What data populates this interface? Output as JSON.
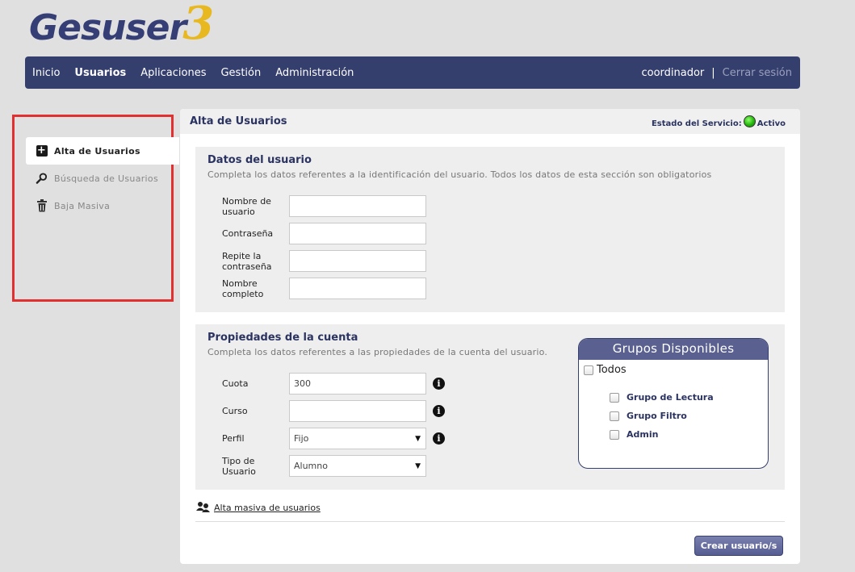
{
  "app": {
    "logo_text": "Gesuser",
    "logo_version": "3"
  },
  "nav": {
    "items": [
      {
        "label": "Inicio"
      },
      {
        "label": "Usuarios",
        "active": true
      },
      {
        "label": "Aplicaciones"
      },
      {
        "label": "Gestión"
      },
      {
        "label": "Administración"
      }
    ],
    "user": "coordinador",
    "separator": "|",
    "logout": "Cerrar sesión"
  },
  "sidebar": {
    "items": [
      {
        "label": "Alta de Usuarios",
        "icon": "plus-square-icon",
        "active": true
      },
      {
        "label": "Búsqueda de Usuarios",
        "icon": "magnifier-icon"
      },
      {
        "label": "Baja Masiva",
        "icon": "trash-icon"
      }
    ]
  },
  "panel": {
    "title": "Alta de Usuarios",
    "service_label": "Estado del Servicio:",
    "service_status": "Activo",
    "service_color": "#25b60c"
  },
  "user_data": {
    "title": "Datos del usuario",
    "description": "Completa los datos referentes a la identificación del usuario. Todos los datos de esta sección son obligatorios",
    "fields": {
      "username": {
        "label": "Nombre de usuario",
        "value": ""
      },
      "password": {
        "label": "Contraseña",
        "value": ""
      },
      "password_repeat": {
        "label": "Repite la contraseña",
        "value": ""
      },
      "fullname": {
        "label": "Nombre completo",
        "value": ""
      }
    }
  },
  "account": {
    "title": "Propiedades de la cuenta",
    "description": "Completa los datos referentes a las propiedades de la cuenta del usuario.",
    "fields": {
      "quota": {
        "label": "Cuota",
        "value": "300"
      },
      "course": {
        "label": "Curso",
        "value": ""
      },
      "profile": {
        "label": "Perfil",
        "value": "Fijo"
      },
      "user_type": {
        "label": "Tipo de Usuario",
        "value": "Alumno"
      }
    }
  },
  "groups": {
    "title": "Grupos Disponibles",
    "all_label": "Todos",
    "items": [
      {
        "label": "Grupo de Lectura",
        "checked": false
      },
      {
        "label": "Grupo Filtro",
        "checked": false
      },
      {
        "label": "Admin",
        "checked": false
      }
    ]
  },
  "bulk_link": "Alta masiva de usuarios",
  "submit_label": "Crear usuario/s",
  "colors": {
    "nav_bg": "#353f6e",
    "accent": "#2b3360",
    "logo_yellow": "#e8b820",
    "highlight": "#e23030"
  }
}
